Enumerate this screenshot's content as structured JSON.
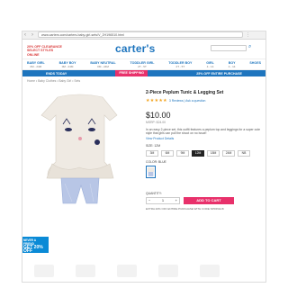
{
  "browser": {
    "url": "www.carters.com/carters-baby-girl-sets/V_2H196510.html",
    "back_glyph": "‹",
    "forward_glyph": "›",
    "menu_glyph": "⋮"
  },
  "header": {
    "promo": "20% OFF CLEARANCE SELECT STYLES ONLINE",
    "logo": "carter's"
  },
  "categories": [
    {
      "label": "BABY GIRL",
      "sub": "0M - 24M"
    },
    {
      "label": "BABY BOY",
      "sub": "0M - 24M"
    },
    {
      "label": "BABY NEUTRAL",
      "sub": "0M - 24M"
    },
    {
      "label": "TODDLER GIRL",
      "sub": "2T - 5T"
    },
    {
      "label": "TODDLER BOY",
      "sub": "2T - 5T"
    },
    {
      "label": "GIRL",
      "sub": "4 - 14"
    },
    {
      "label": "BOY",
      "sub": "4 - 14"
    },
    {
      "label": "SHOES",
      "sub": ""
    }
  ],
  "strip": {
    "left": "ENDS TODAY",
    "middle": "FREE SHIPPING",
    "right": "25% OFF ENTIRE PURCHASE"
  },
  "breadcrumb": "Home • Baby Clothes • Baby Girl • Sets",
  "product": {
    "title": "2-Piece Peplum Tunic & Legging Set",
    "stars": "★★★★★",
    "review_link": "3 Reviews | Ask a question",
    "price": "$10.00",
    "msrp": "MSRP: $24.00",
    "description": "In an easy 2-piece set, this outfit features a peplum top and leggings for a super cute style that girls can pull the shoot on no issue!",
    "view_link": "View Product Details",
    "size_label": "SIZE: 12M",
    "sizes": [
      "3M",
      "6M",
      "9M",
      "12M",
      "18M",
      "24M",
      "NB"
    ],
    "color_label": "COLOR: BLUE",
    "qty_label": "QUANTITY:",
    "qty_value": "1",
    "add_label": "ADD TO CART",
    "ship_note": "EXTRA 20% OFF ENTIRE PURCHASE WITH CODE SPRING18"
  },
  "tile": {
    "line1": "NEVER A FRIEND",
    "big": "GET 20% OFF"
  },
  "colors": {
    "brand_blue": "#1e75be",
    "accent_pink": "#e8316b"
  }
}
